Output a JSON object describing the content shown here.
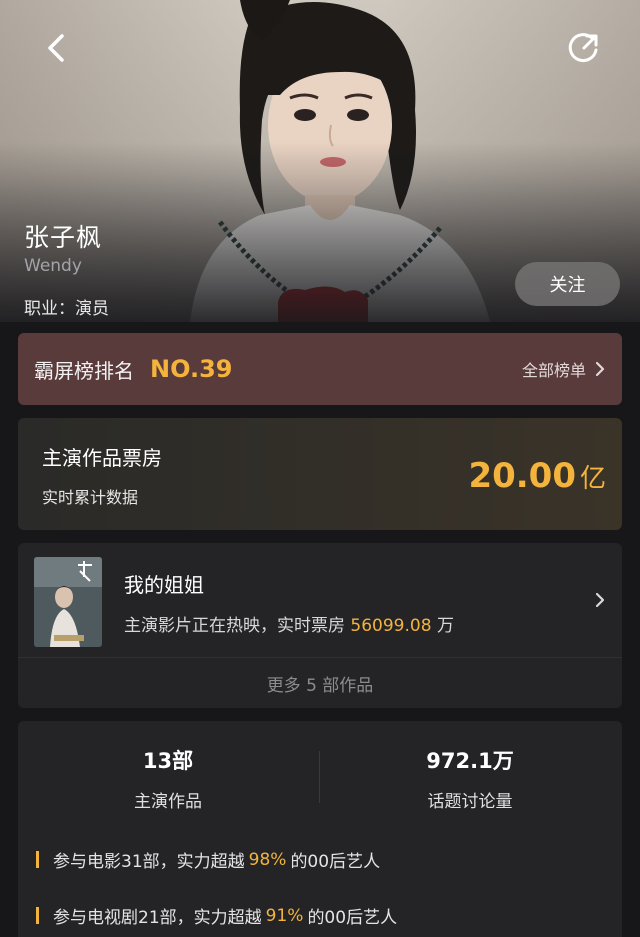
{
  "header": {
    "back_icon": "back-arrow-icon",
    "share_icon": "share-icon"
  },
  "profile": {
    "name": "张子枫",
    "english_name": "Wendy",
    "occupation": "职业：演员",
    "follow_label": "关注"
  },
  "ranking": {
    "label": "霸屏榜排名",
    "value": "NO.39",
    "all_label": "全部榜单",
    "chevron": "›"
  },
  "box_office": {
    "title": "主演作品票房",
    "subtitle": "实时累计数据",
    "amount": "20.00",
    "unit": "亿"
  },
  "film": {
    "title": "我的姐姐",
    "desc_prefix": "主演影片正在热映，实时票房",
    "desc_value": "56099.08",
    "desc_suffix": "万",
    "more_label": "更多 5 部作品",
    "chevron": "›"
  },
  "stats": {
    "works_value": "13部",
    "works_label": "主演作品",
    "discussion_value": "972.1万",
    "discussion_label": "话题讨论量"
  },
  "facts": [
    {
      "prefix": "参与电影31部，实力超越",
      "percent": "98%",
      "suffix": "的00后艺人"
    },
    {
      "prefix": "参与电视剧21部，实力超越",
      "percent": "91%",
      "suffix": "的00后艺人"
    }
  ],
  "colors": {
    "accent": "#f3b33d",
    "rank_bg": "#5a3b3c",
    "card_bg": "#242427",
    "page_bg": "#17171a"
  }
}
